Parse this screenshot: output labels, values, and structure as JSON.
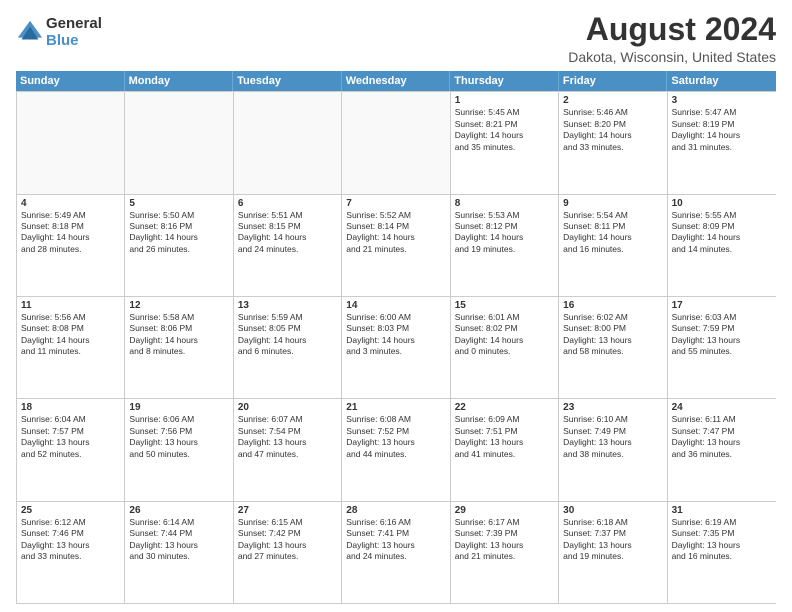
{
  "logo": {
    "general": "General",
    "blue": "Blue"
  },
  "title": "August 2024",
  "location": "Dakota, Wisconsin, United States",
  "days": [
    "Sunday",
    "Monday",
    "Tuesday",
    "Wednesday",
    "Thursday",
    "Friday",
    "Saturday"
  ],
  "rows": [
    [
      {
        "day": "",
        "text": "",
        "empty": true
      },
      {
        "day": "",
        "text": "",
        "empty": true
      },
      {
        "day": "",
        "text": "",
        "empty": true
      },
      {
        "day": "",
        "text": "",
        "empty": true
      },
      {
        "day": "1",
        "text": "Sunrise: 5:45 AM\nSunset: 8:21 PM\nDaylight: 14 hours\nand 35 minutes."
      },
      {
        "day": "2",
        "text": "Sunrise: 5:46 AM\nSunset: 8:20 PM\nDaylight: 14 hours\nand 33 minutes."
      },
      {
        "day": "3",
        "text": "Sunrise: 5:47 AM\nSunset: 8:19 PM\nDaylight: 14 hours\nand 31 minutes."
      }
    ],
    [
      {
        "day": "4",
        "text": "Sunrise: 5:49 AM\nSunset: 8:18 PM\nDaylight: 14 hours\nand 28 minutes."
      },
      {
        "day": "5",
        "text": "Sunrise: 5:50 AM\nSunset: 8:16 PM\nDaylight: 14 hours\nand 26 minutes."
      },
      {
        "day": "6",
        "text": "Sunrise: 5:51 AM\nSunset: 8:15 PM\nDaylight: 14 hours\nand 24 minutes."
      },
      {
        "day": "7",
        "text": "Sunrise: 5:52 AM\nSunset: 8:14 PM\nDaylight: 14 hours\nand 21 minutes."
      },
      {
        "day": "8",
        "text": "Sunrise: 5:53 AM\nSunset: 8:12 PM\nDaylight: 14 hours\nand 19 minutes."
      },
      {
        "day": "9",
        "text": "Sunrise: 5:54 AM\nSunset: 8:11 PM\nDaylight: 14 hours\nand 16 minutes."
      },
      {
        "day": "10",
        "text": "Sunrise: 5:55 AM\nSunset: 8:09 PM\nDaylight: 14 hours\nand 14 minutes."
      }
    ],
    [
      {
        "day": "11",
        "text": "Sunrise: 5:56 AM\nSunset: 8:08 PM\nDaylight: 14 hours\nand 11 minutes."
      },
      {
        "day": "12",
        "text": "Sunrise: 5:58 AM\nSunset: 8:06 PM\nDaylight: 14 hours\nand 8 minutes."
      },
      {
        "day": "13",
        "text": "Sunrise: 5:59 AM\nSunset: 8:05 PM\nDaylight: 14 hours\nand 6 minutes."
      },
      {
        "day": "14",
        "text": "Sunrise: 6:00 AM\nSunset: 8:03 PM\nDaylight: 14 hours\nand 3 minutes."
      },
      {
        "day": "15",
        "text": "Sunrise: 6:01 AM\nSunset: 8:02 PM\nDaylight: 14 hours\nand 0 minutes."
      },
      {
        "day": "16",
        "text": "Sunrise: 6:02 AM\nSunset: 8:00 PM\nDaylight: 13 hours\nand 58 minutes."
      },
      {
        "day": "17",
        "text": "Sunrise: 6:03 AM\nSunset: 7:59 PM\nDaylight: 13 hours\nand 55 minutes."
      }
    ],
    [
      {
        "day": "18",
        "text": "Sunrise: 6:04 AM\nSunset: 7:57 PM\nDaylight: 13 hours\nand 52 minutes."
      },
      {
        "day": "19",
        "text": "Sunrise: 6:06 AM\nSunset: 7:56 PM\nDaylight: 13 hours\nand 50 minutes."
      },
      {
        "day": "20",
        "text": "Sunrise: 6:07 AM\nSunset: 7:54 PM\nDaylight: 13 hours\nand 47 minutes."
      },
      {
        "day": "21",
        "text": "Sunrise: 6:08 AM\nSunset: 7:52 PM\nDaylight: 13 hours\nand 44 minutes."
      },
      {
        "day": "22",
        "text": "Sunrise: 6:09 AM\nSunset: 7:51 PM\nDaylight: 13 hours\nand 41 minutes."
      },
      {
        "day": "23",
        "text": "Sunrise: 6:10 AM\nSunset: 7:49 PM\nDaylight: 13 hours\nand 38 minutes."
      },
      {
        "day": "24",
        "text": "Sunrise: 6:11 AM\nSunset: 7:47 PM\nDaylight: 13 hours\nand 36 minutes."
      }
    ],
    [
      {
        "day": "25",
        "text": "Sunrise: 6:12 AM\nSunset: 7:46 PM\nDaylight: 13 hours\nand 33 minutes."
      },
      {
        "day": "26",
        "text": "Sunrise: 6:14 AM\nSunset: 7:44 PM\nDaylight: 13 hours\nand 30 minutes."
      },
      {
        "day": "27",
        "text": "Sunrise: 6:15 AM\nSunset: 7:42 PM\nDaylight: 13 hours\nand 27 minutes."
      },
      {
        "day": "28",
        "text": "Sunrise: 6:16 AM\nSunset: 7:41 PM\nDaylight: 13 hours\nand 24 minutes."
      },
      {
        "day": "29",
        "text": "Sunrise: 6:17 AM\nSunset: 7:39 PM\nDaylight: 13 hours\nand 21 minutes."
      },
      {
        "day": "30",
        "text": "Sunrise: 6:18 AM\nSunset: 7:37 PM\nDaylight: 13 hours\nand 19 minutes."
      },
      {
        "day": "31",
        "text": "Sunrise: 6:19 AM\nSunset: 7:35 PM\nDaylight: 13 hours\nand 16 minutes."
      }
    ]
  ]
}
